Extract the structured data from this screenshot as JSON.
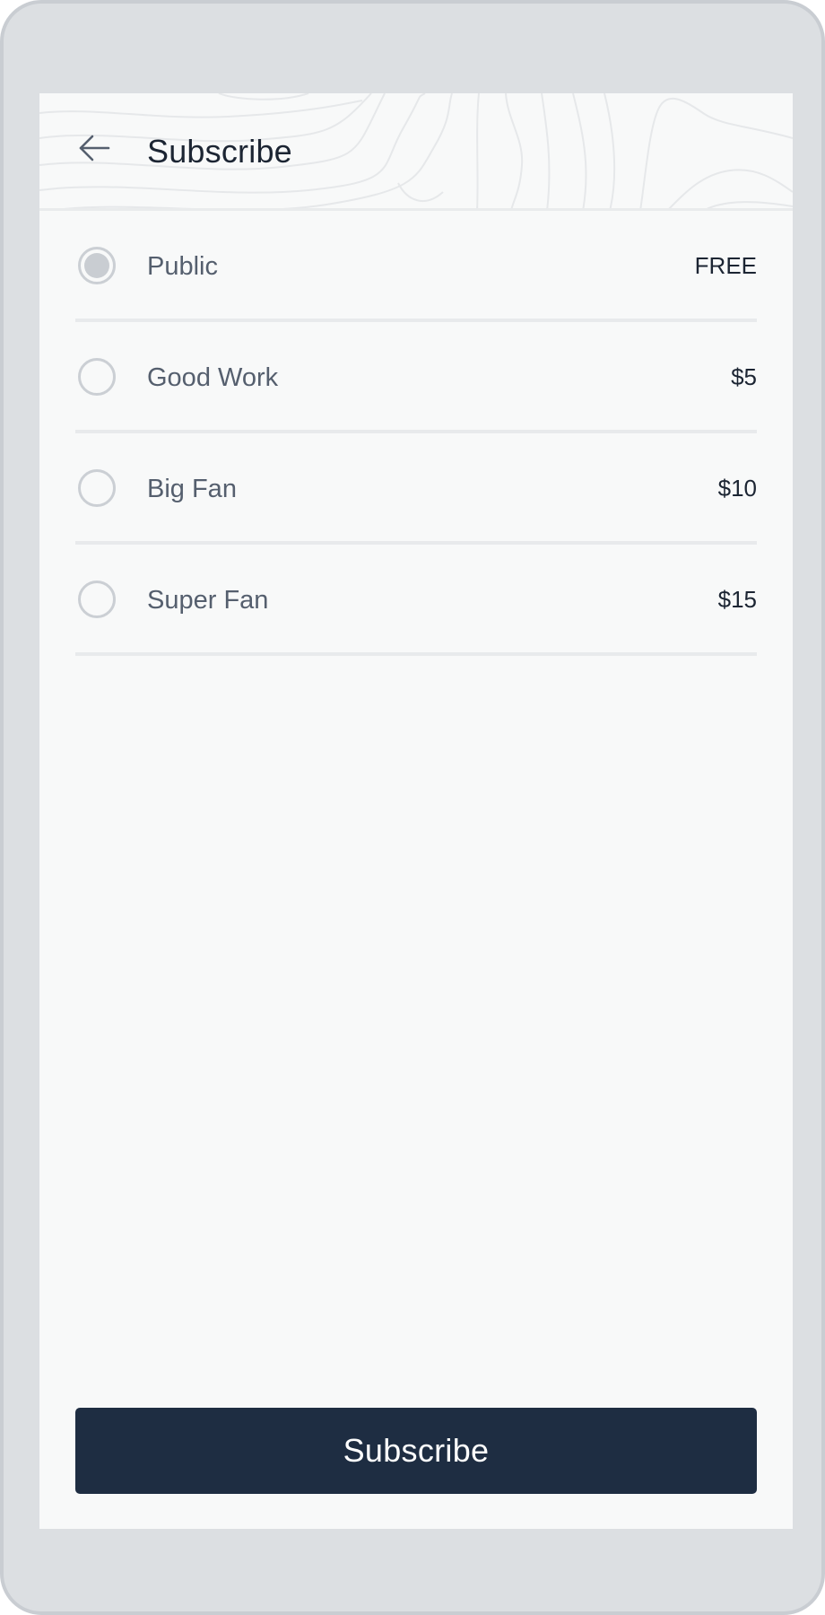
{
  "header": {
    "title": "Subscribe",
    "back_icon": "arrow-left-icon"
  },
  "tiers": [
    {
      "name": "Public",
      "price": "FREE",
      "selected": true
    },
    {
      "name": "Good Work",
      "price": "$5",
      "selected": false
    },
    {
      "name": "Big Fan",
      "price": "$10",
      "selected": false
    },
    {
      "name": "Super Fan",
      "price": "$15",
      "selected": false
    }
  ],
  "footer": {
    "subscribe_label": "Subscribe"
  },
  "colors": {
    "device_frame": "#dcdfe2",
    "screen_background": "#f8f9f9",
    "primary_button": "#1e2d42",
    "text_primary": "#1c2533",
    "text_secondary": "#555f6e",
    "divider": "#e8eaec"
  }
}
